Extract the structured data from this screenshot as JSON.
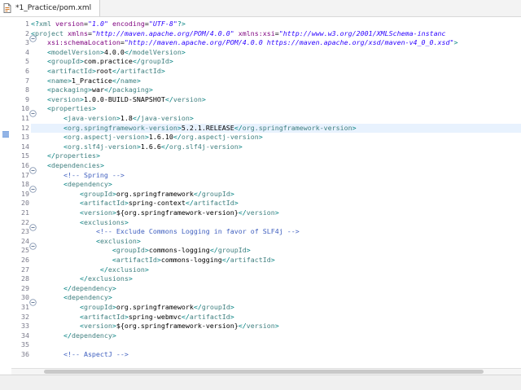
{
  "tab": {
    "title": "*1_Practice/pom.xml",
    "icon": "xml-file-icon"
  },
  "editor": {
    "current_line": 12,
    "lines": [
      {
        "n": "1",
        "fold": false,
        "segs": [
          [
            "pi",
            "<?"
          ],
          [
            "t",
            "xml"
          ],
          [
            "an",
            " version"
          ],
          [
            "tx",
            "="
          ],
          [
            "av",
            "\"1.0\""
          ],
          [
            "an",
            " encoding"
          ],
          [
            "tx",
            "="
          ],
          [
            "av",
            "\"UTF-8\""
          ],
          [
            "pi",
            "?>"
          ]
        ]
      },
      {
        "n": "2",
        "fold": true,
        "segs": [
          [
            "b",
            "<"
          ],
          [
            "t",
            "project"
          ],
          [
            "an",
            " xmlns"
          ],
          [
            "tx",
            "="
          ],
          [
            "av",
            "\"http://maven.apache.org/POM/4.0.0\""
          ],
          [
            "an",
            " xmlns:xsi"
          ],
          [
            "tx",
            "="
          ],
          [
            "av",
            "\"http://www.w3.org/2001/XMLSchema-instanc"
          ]
        ]
      },
      {
        "n": "3",
        "fold": false,
        "segs": [
          [
            "an",
            "    xsi:schemaLocation"
          ],
          [
            "tx",
            "="
          ],
          [
            "av",
            "\"http://maven.apache.org/POM/4.0.0 https://maven.apache.org/xsd/maven-v4_0_0.xsd\""
          ],
          [
            "b",
            ">"
          ]
        ]
      },
      {
        "n": "4",
        "fold": false,
        "segs": [
          [
            "tx",
            "    "
          ],
          [
            "b",
            "<"
          ],
          [
            "t",
            "modelVersion"
          ],
          [
            "b",
            ">"
          ],
          [
            "tx",
            "4.0.0"
          ],
          [
            "b",
            "</"
          ],
          [
            "t",
            "modelVersion"
          ],
          [
            "b",
            ">"
          ]
        ]
      },
      {
        "n": "5",
        "fold": false,
        "segs": [
          [
            "tx",
            "    "
          ],
          [
            "b",
            "<"
          ],
          [
            "t",
            "groupId"
          ],
          [
            "b",
            ">"
          ],
          [
            "tx",
            "com.practice"
          ],
          [
            "b",
            "</"
          ],
          [
            "t",
            "groupId"
          ],
          [
            "b",
            ">"
          ]
        ]
      },
      {
        "n": "6",
        "fold": false,
        "segs": [
          [
            "tx",
            "    "
          ],
          [
            "b",
            "<"
          ],
          [
            "t",
            "artifactId"
          ],
          [
            "b",
            ">"
          ],
          [
            "tx",
            "root"
          ],
          [
            "b",
            "</"
          ],
          [
            "t",
            "artifactId"
          ],
          [
            "b",
            ">"
          ]
        ]
      },
      {
        "n": "7",
        "fold": false,
        "segs": [
          [
            "tx",
            "    "
          ],
          [
            "b",
            "<"
          ],
          [
            "t",
            "name"
          ],
          [
            "b",
            ">"
          ],
          [
            "tx",
            "1_Practice"
          ],
          [
            "b",
            "</"
          ],
          [
            "t",
            "name"
          ],
          [
            "b",
            ">"
          ]
        ]
      },
      {
        "n": "8",
        "fold": false,
        "segs": [
          [
            "tx",
            "    "
          ],
          [
            "b",
            "<"
          ],
          [
            "t",
            "packaging"
          ],
          [
            "b",
            ">"
          ],
          [
            "tx",
            "war"
          ],
          [
            "b",
            "</"
          ],
          [
            "t",
            "packaging"
          ],
          [
            "b",
            ">"
          ]
        ]
      },
      {
        "n": "9",
        "fold": false,
        "segs": [
          [
            "tx",
            "    "
          ],
          [
            "b",
            "<"
          ],
          [
            "t",
            "version"
          ],
          [
            "b",
            ">"
          ],
          [
            "tx",
            "1.0.0-BUILD-SNAPSHOT"
          ],
          [
            "b",
            "</"
          ],
          [
            "t",
            "version"
          ],
          [
            "b",
            ">"
          ]
        ]
      },
      {
        "n": "10",
        "fold": true,
        "segs": [
          [
            "tx",
            "    "
          ],
          [
            "b",
            "<"
          ],
          [
            "t",
            "properties"
          ],
          [
            "b",
            ">"
          ]
        ]
      },
      {
        "n": "11",
        "fold": false,
        "segs": [
          [
            "tx",
            "        "
          ],
          [
            "b",
            "<"
          ],
          [
            "t",
            "java-version"
          ],
          [
            "b",
            ">"
          ],
          [
            "tx",
            "1.8"
          ],
          [
            "b",
            "</"
          ],
          [
            "t",
            "java-version"
          ],
          [
            "b",
            ">"
          ]
        ]
      },
      {
        "n": "12",
        "fold": false,
        "segs": [
          [
            "tx",
            "        "
          ],
          [
            "b",
            "<"
          ],
          [
            "t",
            "org.springframework-version"
          ],
          [
            "b",
            ">"
          ],
          [
            "tx",
            "5.2.1.RELEASE"
          ],
          [
            "b",
            "</"
          ],
          [
            "t",
            "org.springframework-version"
          ],
          [
            "b",
            ">"
          ]
        ]
      },
      {
        "n": "13",
        "fold": false,
        "segs": [
          [
            "tx",
            "        "
          ],
          [
            "b",
            "<"
          ],
          [
            "t",
            "org.aspectj-version"
          ],
          [
            "b",
            ">"
          ],
          [
            "tx",
            "1.6.10"
          ],
          [
            "b",
            "</"
          ],
          [
            "t",
            "org.aspectj-version"
          ],
          [
            "b",
            ">"
          ]
        ]
      },
      {
        "n": "14",
        "fold": false,
        "segs": [
          [
            "tx",
            "        "
          ],
          [
            "b",
            "<"
          ],
          [
            "t",
            "org.slf4j-version"
          ],
          [
            "b",
            ">"
          ],
          [
            "tx",
            "1.6.6"
          ],
          [
            "b",
            "</"
          ],
          [
            "t",
            "org.slf4j-version"
          ],
          [
            "b",
            ">"
          ]
        ]
      },
      {
        "n": "15",
        "fold": false,
        "segs": [
          [
            "tx",
            "    "
          ],
          [
            "b",
            "</"
          ],
          [
            "t",
            "properties"
          ],
          [
            "b",
            ">"
          ]
        ]
      },
      {
        "n": "16",
        "fold": true,
        "segs": [
          [
            "tx",
            "    "
          ],
          [
            "b",
            "<"
          ],
          [
            "t",
            "dependencies"
          ],
          [
            "b",
            ">"
          ]
        ]
      },
      {
        "n": "17",
        "fold": false,
        "segs": [
          [
            "tx",
            "        "
          ],
          [
            "cm",
            "<!-- Spring -->"
          ]
        ]
      },
      {
        "n": "18",
        "fold": true,
        "segs": [
          [
            "tx",
            "        "
          ],
          [
            "b",
            "<"
          ],
          [
            "t",
            "dependency"
          ],
          [
            "b",
            ">"
          ]
        ]
      },
      {
        "n": "19",
        "fold": false,
        "segs": [
          [
            "tx",
            "            "
          ],
          [
            "b",
            "<"
          ],
          [
            "t",
            "groupId"
          ],
          [
            "b",
            ">"
          ],
          [
            "tx",
            "org.springframework"
          ],
          [
            "b",
            "</"
          ],
          [
            "t",
            "groupId"
          ],
          [
            "b",
            ">"
          ]
        ]
      },
      {
        "n": "20",
        "fold": false,
        "segs": [
          [
            "tx",
            "            "
          ],
          [
            "b",
            "<"
          ],
          [
            "t",
            "artifactId"
          ],
          [
            "b",
            ">"
          ],
          [
            "tx",
            "spring-context"
          ],
          [
            "b",
            "</"
          ],
          [
            "t",
            "artifactId"
          ],
          [
            "b",
            ">"
          ]
        ]
      },
      {
        "n": "21",
        "fold": false,
        "segs": [
          [
            "tx",
            "            "
          ],
          [
            "b",
            "<"
          ],
          [
            "t",
            "version"
          ],
          [
            "b",
            ">"
          ],
          [
            "tx",
            "${org.springframework-version}"
          ],
          [
            "b",
            "</"
          ],
          [
            "t",
            "version"
          ],
          [
            "b",
            ">"
          ]
        ]
      },
      {
        "n": "22",
        "fold": true,
        "segs": [
          [
            "tx",
            "            "
          ],
          [
            "b",
            "<"
          ],
          [
            "t",
            "exclusions"
          ],
          [
            "b",
            ">"
          ]
        ]
      },
      {
        "n": "23",
        "fold": false,
        "segs": [
          [
            "tx",
            "                "
          ],
          [
            "cm",
            "<!-- Exclude Commons Logging in favor of SLF4j -->"
          ]
        ]
      },
      {
        "n": "24",
        "fold": true,
        "segs": [
          [
            "tx",
            "                "
          ],
          [
            "b",
            "<"
          ],
          [
            "t",
            "exclusion"
          ],
          [
            "b",
            ">"
          ]
        ]
      },
      {
        "n": "25",
        "fold": false,
        "segs": [
          [
            "tx",
            "                    "
          ],
          [
            "b",
            "<"
          ],
          [
            "t",
            "groupId"
          ],
          [
            "b",
            ">"
          ],
          [
            "tx",
            "commons-logging"
          ],
          [
            "b",
            "</"
          ],
          [
            "t",
            "groupId"
          ],
          [
            "b",
            ">"
          ]
        ]
      },
      {
        "n": "26",
        "fold": false,
        "segs": [
          [
            "tx",
            "                    "
          ],
          [
            "b",
            "<"
          ],
          [
            "t",
            "artifactId"
          ],
          [
            "b",
            ">"
          ],
          [
            "tx",
            "commons-logging"
          ],
          [
            "b",
            "</"
          ],
          [
            "t",
            "artifactId"
          ],
          [
            "b",
            ">"
          ]
        ]
      },
      {
        "n": "27",
        "fold": false,
        "segs": [
          [
            "tx",
            "                 "
          ],
          [
            "b",
            "</"
          ],
          [
            "t",
            "exclusion"
          ],
          [
            "b",
            ">"
          ]
        ]
      },
      {
        "n": "28",
        "fold": false,
        "segs": [
          [
            "tx",
            "            "
          ],
          [
            "b",
            "</"
          ],
          [
            "t",
            "exclusions"
          ],
          [
            "b",
            ">"
          ]
        ]
      },
      {
        "n": "29",
        "fold": false,
        "segs": [
          [
            "tx",
            "        "
          ],
          [
            "b",
            "</"
          ],
          [
            "t",
            "dependency"
          ],
          [
            "b",
            ">"
          ]
        ]
      },
      {
        "n": "30",
        "fold": true,
        "segs": [
          [
            "tx",
            "        "
          ],
          [
            "b",
            "<"
          ],
          [
            "t",
            "dependency"
          ],
          [
            "b",
            ">"
          ]
        ]
      },
      {
        "n": "31",
        "fold": false,
        "segs": [
          [
            "tx",
            "            "
          ],
          [
            "b",
            "<"
          ],
          [
            "t",
            "groupId"
          ],
          [
            "b",
            ">"
          ],
          [
            "tx",
            "org.springframework"
          ],
          [
            "b",
            "</"
          ],
          [
            "t",
            "groupId"
          ],
          [
            "b",
            ">"
          ]
        ]
      },
      {
        "n": "32",
        "fold": false,
        "segs": [
          [
            "tx",
            "            "
          ],
          [
            "b",
            "<"
          ],
          [
            "t",
            "artifactId"
          ],
          [
            "b",
            ">"
          ],
          [
            "tx",
            "spring-webmvc"
          ],
          [
            "b",
            "</"
          ],
          [
            "t",
            "artifactId"
          ],
          [
            "b",
            ">"
          ]
        ]
      },
      {
        "n": "33",
        "fold": false,
        "segs": [
          [
            "tx",
            "            "
          ],
          [
            "b",
            "<"
          ],
          [
            "t",
            "version"
          ],
          [
            "b",
            ">"
          ],
          [
            "tx",
            "${org.springframework-version}"
          ],
          [
            "b",
            "</"
          ],
          [
            "t",
            "version"
          ],
          [
            "b",
            ">"
          ]
        ]
      },
      {
        "n": "34",
        "fold": false,
        "segs": [
          [
            "tx",
            "        "
          ],
          [
            "b",
            "</"
          ],
          [
            "t",
            "dependency"
          ],
          [
            "b",
            ">"
          ]
        ]
      },
      {
        "n": "35",
        "fold": false,
        "segs": []
      },
      {
        "n": "36",
        "fold": false,
        "segs": [
          [
            "tx",
            "        "
          ],
          [
            "cm",
            "<!-- AspectJ -->"
          ]
        ]
      }
    ]
  },
  "colors": {
    "current_line_bg": "#e8f2fe",
    "tag": "#3f7f7f",
    "attr_name": "#7f007f",
    "attr_value": "#2a00ff",
    "comment": "#3f5fbf"
  }
}
